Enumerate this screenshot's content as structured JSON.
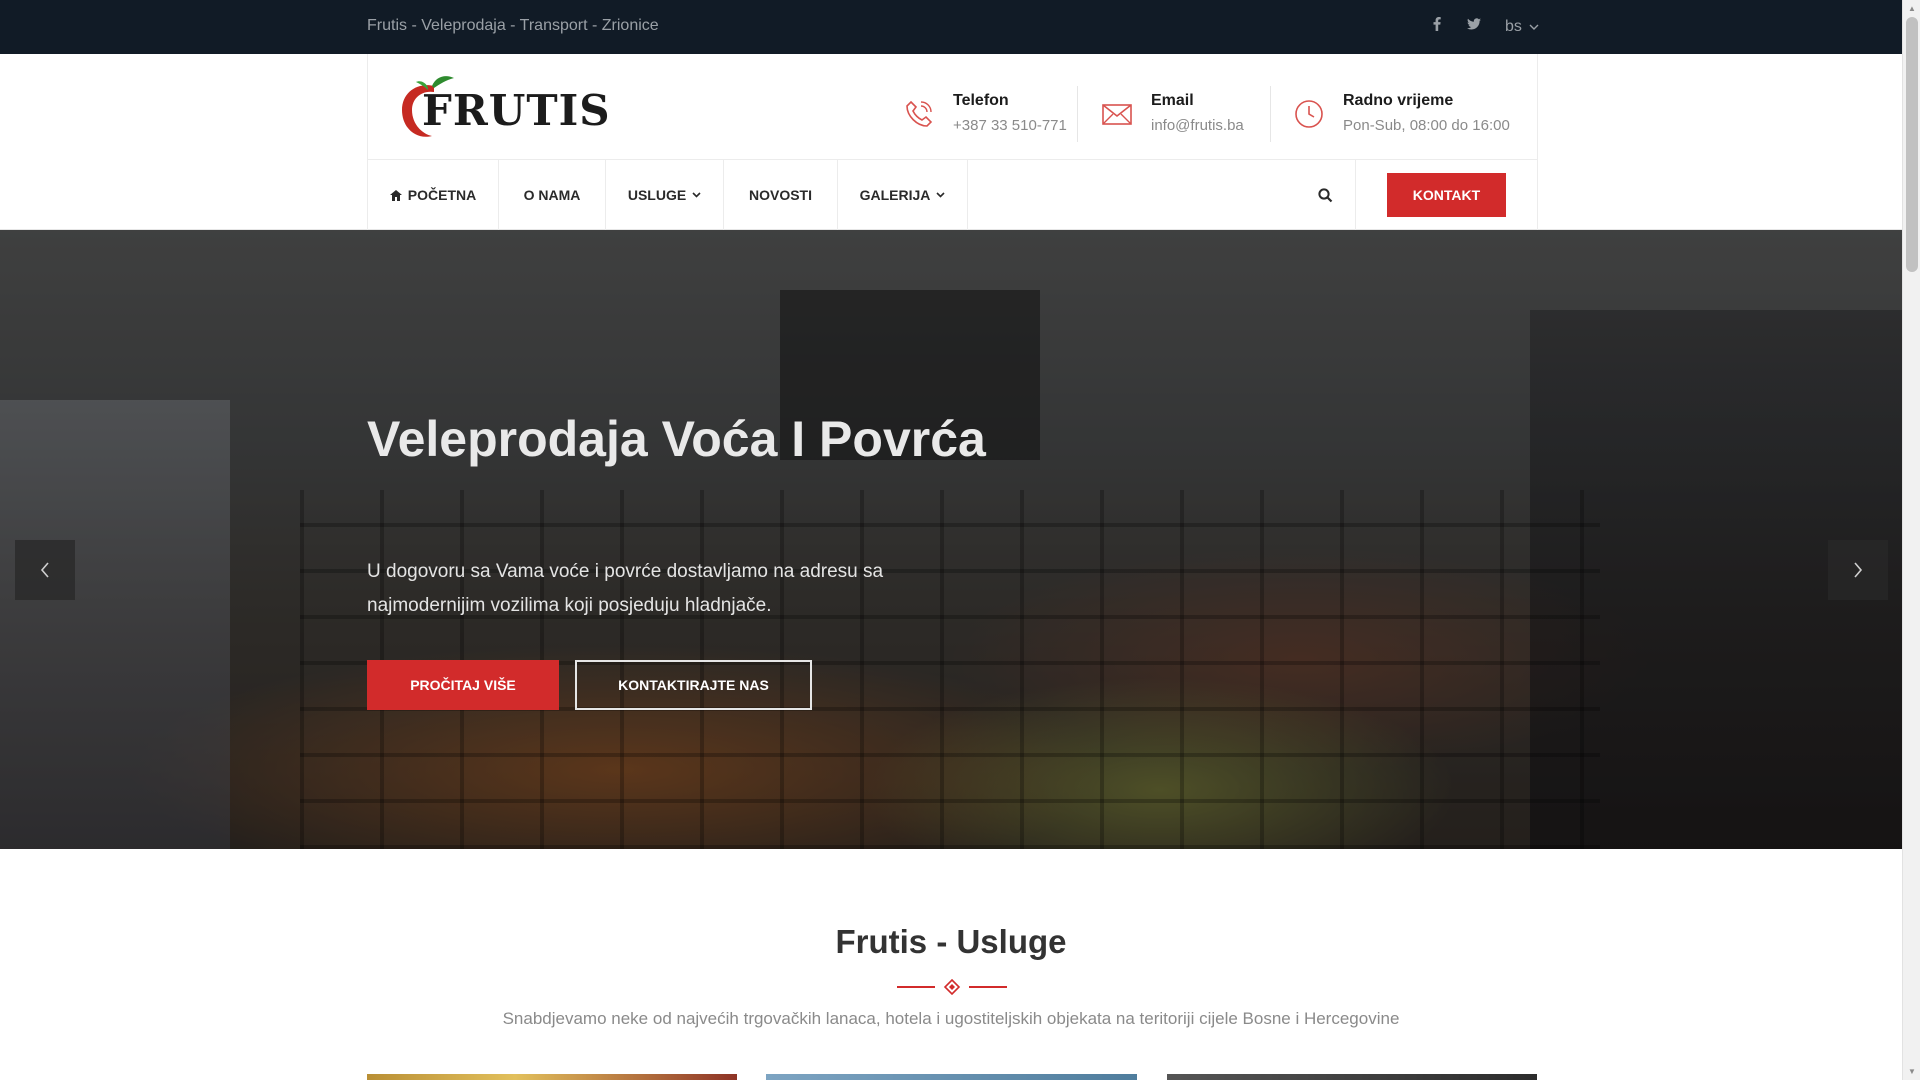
{
  "topbar": {
    "tagline": "Frutis - Veleprodaja - Transport - Zrionice",
    "social": [
      {
        "icon": "facebook-icon",
        "glyph": "f"
      },
      {
        "icon": "twitter-icon",
        "glyph": "t"
      }
    ],
    "language": "bs"
  },
  "header": {
    "logo_text": "FRUTIS",
    "info": [
      {
        "icon": "phone-icon",
        "label": "Telefon",
        "value": "+387 33 510-771"
      },
      {
        "icon": "envelope-icon",
        "label": "Email",
        "value": "info@frutis.ba"
      },
      {
        "icon": "clock-icon",
        "label": "Radno vrijeme",
        "value": "Pon-Sub, 08:00 do 16:00"
      }
    ]
  },
  "nav": {
    "items": [
      {
        "label": "POČETNA",
        "icon": "home-icon"
      },
      {
        "label": "O NAMA"
      },
      {
        "label": "USLUGE",
        "dropdown": true
      },
      {
        "label": "NOVOSTI"
      },
      {
        "label": "GALERIJA",
        "dropdown": true
      }
    ],
    "contact_button": "KONTAKT"
  },
  "hero": {
    "title": "Veleprodaja Voća I Povrća",
    "text": "U dogovoru sa Vama voće i povrće dostavljamo na adresu sa najmodernijim vozilima koji posjeduju hladnjače.",
    "read_more": "PROČITAJ VIŠE",
    "contact_us": "KONTAKTIRAJTE NAS"
  },
  "services": {
    "title": "Frutis - Usluge",
    "subtitle": "Snabdjevamo neke od najvećih trgovačkih lanaca, hotela i ugostiteljskih objekata na teritoriji cijele Bosne i Hercegovine"
  },
  "colors": {
    "accent": "#d22b2b",
    "topbar": "#111b26"
  }
}
